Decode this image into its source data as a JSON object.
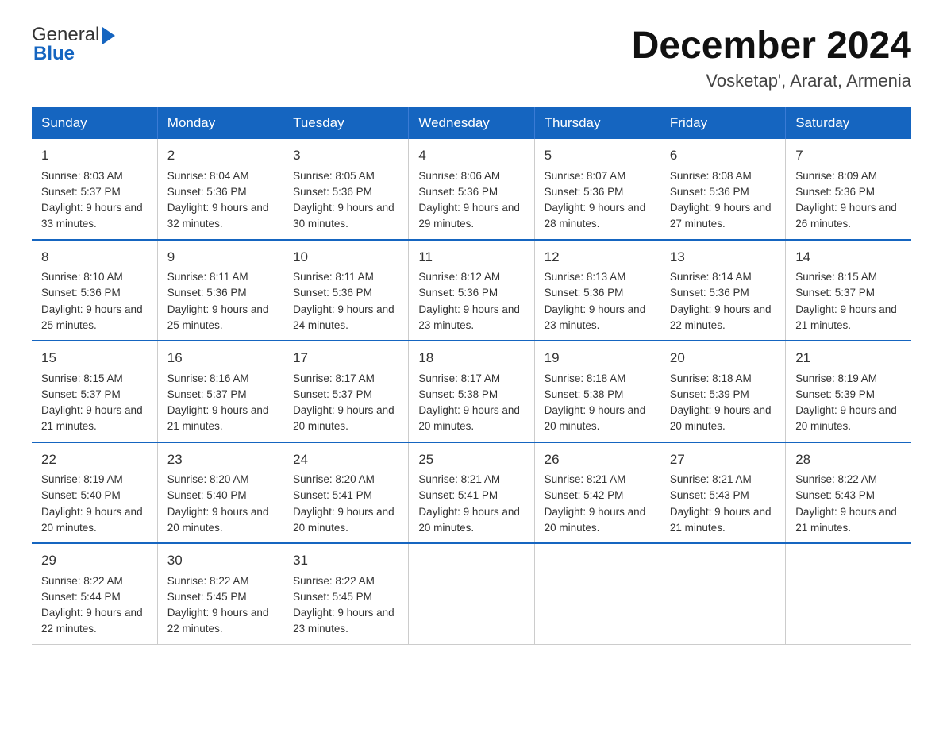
{
  "header": {
    "logo_general": "General",
    "logo_blue": "Blue",
    "month_title": "December 2024",
    "location": "Vosketap', Ararat, Armenia"
  },
  "days_of_week": [
    "Sunday",
    "Monday",
    "Tuesday",
    "Wednesday",
    "Thursday",
    "Friday",
    "Saturday"
  ],
  "weeks": [
    [
      {
        "day": "1",
        "sunrise": "Sunrise: 8:03 AM",
        "sunset": "Sunset: 5:37 PM",
        "daylight": "Daylight: 9 hours and 33 minutes."
      },
      {
        "day": "2",
        "sunrise": "Sunrise: 8:04 AM",
        "sunset": "Sunset: 5:36 PM",
        "daylight": "Daylight: 9 hours and 32 minutes."
      },
      {
        "day": "3",
        "sunrise": "Sunrise: 8:05 AM",
        "sunset": "Sunset: 5:36 PM",
        "daylight": "Daylight: 9 hours and 30 minutes."
      },
      {
        "day": "4",
        "sunrise": "Sunrise: 8:06 AM",
        "sunset": "Sunset: 5:36 PM",
        "daylight": "Daylight: 9 hours and 29 minutes."
      },
      {
        "day": "5",
        "sunrise": "Sunrise: 8:07 AM",
        "sunset": "Sunset: 5:36 PM",
        "daylight": "Daylight: 9 hours and 28 minutes."
      },
      {
        "day": "6",
        "sunrise": "Sunrise: 8:08 AM",
        "sunset": "Sunset: 5:36 PM",
        "daylight": "Daylight: 9 hours and 27 minutes."
      },
      {
        "day": "7",
        "sunrise": "Sunrise: 8:09 AM",
        "sunset": "Sunset: 5:36 PM",
        "daylight": "Daylight: 9 hours and 26 minutes."
      }
    ],
    [
      {
        "day": "8",
        "sunrise": "Sunrise: 8:10 AM",
        "sunset": "Sunset: 5:36 PM",
        "daylight": "Daylight: 9 hours and 25 minutes."
      },
      {
        "day": "9",
        "sunrise": "Sunrise: 8:11 AM",
        "sunset": "Sunset: 5:36 PM",
        "daylight": "Daylight: 9 hours and 25 minutes."
      },
      {
        "day": "10",
        "sunrise": "Sunrise: 8:11 AM",
        "sunset": "Sunset: 5:36 PM",
        "daylight": "Daylight: 9 hours and 24 minutes."
      },
      {
        "day": "11",
        "sunrise": "Sunrise: 8:12 AM",
        "sunset": "Sunset: 5:36 PM",
        "daylight": "Daylight: 9 hours and 23 minutes."
      },
      {
        "day": "12",
        "sunrise": "Sunrise: 8:13 AM",
        "sunset": "Sunset: 5:36 PM",
        "daylight": "Daylight: 9 hours and 23 minutes."
      },
      {
        "day": "13",
        "sunrise": "Sunrise: 8:14 AM",
        "sunset": "Sunset: 5:36 PM",
        "daylight": "Daylight: 9 hours and 22 minutes."
      },
      {
        "day": "14",
        "sunrise": "Sunrise: 8:15 AM",
        "sunset": "Sunset: 5:37 PM",
        "daylight": "Daylight: 9 hours and 21 minutes."
      }
    ],
    [
      {
        "day": "15",
        "sunrise": "Sunrise: 8:15 AM",
        "sunset": "Sunset: 5:37 PM",
        "daylight": "Daylight: 9 hours and 21 minutes."
      },
      {
        "day": "16",
        "sunrise": "Sunrise: 8:16 AM",
        "sunset": "Sunset: 5:37 PM",
        "daylight": "Daylight: 9 hours and 21 minutes."
      },
      {
        "day": "17",
        "sunrise": "Sunrise: 8:17 AM",
        "sunset": "Sunset: 5:37 PM",
        "daylight": "Daylight: 9 hours and 20 minutes."
      },
      {
        "day": "18",
        "sunrise": "Sunrise: 8:17 AM",
        "sunset": "Sunset: 5:38 PM",
        "daylight": "Daylight: 9 hours and 20 minutes."
      },
      {
        "day": "19",
        "sunrise": "Sunrise: 8:18 AM",
        "sunset": "Sunset: 5:38 PM",
        "daylight": "Daylight: 9 hours and 20 minutes."
      },
      {
        "day": "20",
        "sunrise": "Sunrise: 8:18 AM",
        "sunset": "Sunset: 5:39 PM",
        "daylight": "Daylight: 9 hours and 20 minutes."
      },
      {
        "day": "21",
        "sunrise": "Sunrise: 8:19 AM",
        "sunset": "Sunset: 5:39 PM",
        "daylight": "Daylight: 9 hours and 20 minutes."
      }
    ],
    [
      {
        "day": "22",
        "sunrise": "Sunrise: 8:19 AM",
        "sunset": "Sunset: 5:40 PM",
        "daylight": "Daylight: 9 hours and 20 minutes."
      },
      {
        "day": "23",
        "sunrise": "Sunrise: 8:20 AM",
        "sunset": "Sunset: 5:40 PM",
        "daylight": "Daylight: 9 hours and 20 minutes."
      },
      {
        "day": "24",
        "sunrise": "Sunrise: 8:20 AM",
        "sunset": "Sunset: 5:41 PM",
        "daylight": "Daylight: 9 hours and 20 minutes."
      },
      {
        "day": "25",
        "sunrise": "Sunrise: 8:21 AM",
        "sunset": "Sunset: 5:41 PM",
        "daylight": "Daylight: 9 hours and 20 minutes."
      },
      {
        "day": "26",
        "sunrise": "Sunrise: 8:21 AM",
        "sunset": "Sunset: 5:42 PM",
        "daylight": "Daylight: 9 hours and 20 minutes."
      },
      {
        "day": "27",
        "sunrise": "Sunrise: 8:21 AM",
        "sunset": "Sunset: 5:43 PM",
        "daylight": "Daylight: 9 hours and 21 minutes."
      },
      {
        "day": "28",
        "sunrise": "Sunrise: 8:22 AM",
        "sunset": "Sunset: 5:43 PM",
        "daylight": "Daylight: 9 hours and 21 minutes."
      }
    ],
    [
      {
        "day": "29",
        "sunrise": "Sunrise: 8:22 AM",
        "sunset": "Sunset: 5:44 PM",
        "daylight": "Daylight: 9 hours and 22 minutes."
      },
      {
        "day": "30",
        "sunrise": "Sunrise: 8:22 AM",
        "sunset": "Sunset: 5:45 PM",
        "daylight": "Daylight: 9 hours and 22 minutes."
      },
      {
        "day": "31",
        "sunrise": "Sunrise: 8:22 AM",
        "sunset": "Sunset: 5:45 PM",
        "daylight": "Daylight: 9 hours and 23 minutes."
      },
      null,
      null,
      null,
      null
    ]
  ]
}
